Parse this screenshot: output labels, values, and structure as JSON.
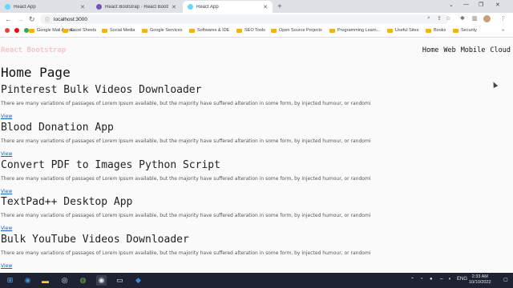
{
  "browser": {
    "tabs": [
      {
        "label": "React App",
        "favicon_color": "#61dafb",
        "active": false
      },
      {
        "label": "React Bootstrap · React Bootstrap",
        "favicon_color": "#7952b3",
        "active": false
      },
      {
        "label": "React App",
        "favicon_color": "#61dafb",
        "active": true
      }
    ],
    "url": "localhost:3000",
    "bookmarks": [
      {
        "label": "",
        "icon": "gmail-icon"
      },
      {
        "label": "",
        "icon": "youtube-icon"
      },
      {
        "label": "",
        "icon": "maps-icon"
      },
      {
        "label": "Google Mail Accou...",
        "icon": "folder-icon"
      },
      {
        "label": "Excel Sheets",
        "icon": "folder-icon"
      },
      {
        "label": "Social Media",
        "icon": "folder-icon"
      },
      {
        "label": "Google Services",
        "icon": "folder-icon"
      },
      {
        "label": "Softwares & IDE",
        "icon": "folder-icon"
      },
      {
        "label": "SEO Tools",
        "icon": "folder-icon"
      },
      {
        "label": "Open Source Projects",
        "icon": "folder-icon"
      },
      {
        "label": "Programming Learn...",
        "icon": "folder-icon"
      },
      {
        "label": "Useful Sites",
        "icon": "folder-icon"
      },
      {
        "label": "Books",
        "icon": "folder-icon"
      },
      {
        "label": "Security",
        "icon": "folder-icon"
      }
    ]
  },
  "page": {
    "brand": "React Bootstrap",
    "nav": [
      "Home",
      "Web",
      "Mobile",
      "Cloud"
    ],
    "heading": "Home Page",
    "projects": [
      {
        "title": "Pinterest Bulk Videos Downloader",
        "description": "There are many variations of passages of Lorem Ipsum available, but the majority have suffered alteration in some form, by injected humour, or randomi",
        "link": "View"
      },
      {
        "title": "Blood Donation App",
        "description": "There are many variations of passages of Lorem Ipsum available, but the majority have suffered alteration in some form, by injected humour, or randomi",
        "link": "View"
      },
      {
        "title": "Convert PDF to Images Python Script",
        "description": "There are many variations of passages of Lorem Ipsum available, but the majority have suffered alteration in some form, by injected humour, or randomi",
        "link": "View"
      },
      {
        "title": "TextPad++ Desktop App",
        "description": "There are many variations of passages of Lorem Ipsum available, but the majority have suffered alteration in some form, by injected humour, or randomi",
        "link": "View"
      },
      {
        "title": "Bulk YouTube Videos Downloader",
        "description": "There are many variations of passages of Lorem Ipsum available, but the majority have suffered alteration in some form, by injected humour, or randomi",
        "link": "View"
      }
    ]
  },
  "taskbar": {
    "language": "ENG",
    "time": "2:33 AM",
    "date": "10/10/2022"
  },
  "colors": {
    "brand": "#f4c6c6",
    "link": "#1a5cc8",
    "taskbar": "#1f2233",
    "tabstrip": "#dee1e6"
  }
}
